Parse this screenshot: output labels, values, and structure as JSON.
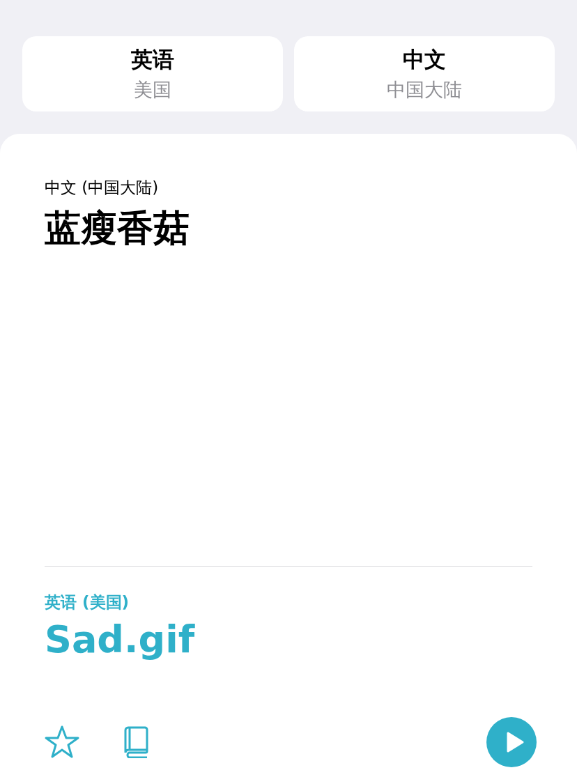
{
  "language_pair": [
    {
      "language": "英语",
      "region": "美国"
    },
    {
      "language": "中文",
      "region": "中国大陆"
    }
  ],
  "source": {
    "label": "中文 (中国大陆)",
    "text": "蓝瘦香菇"
  },
  "translation": {
    "label": "英语 (美国)",
    "text": "Sad.gif",
    "favorited": false
  }
}
